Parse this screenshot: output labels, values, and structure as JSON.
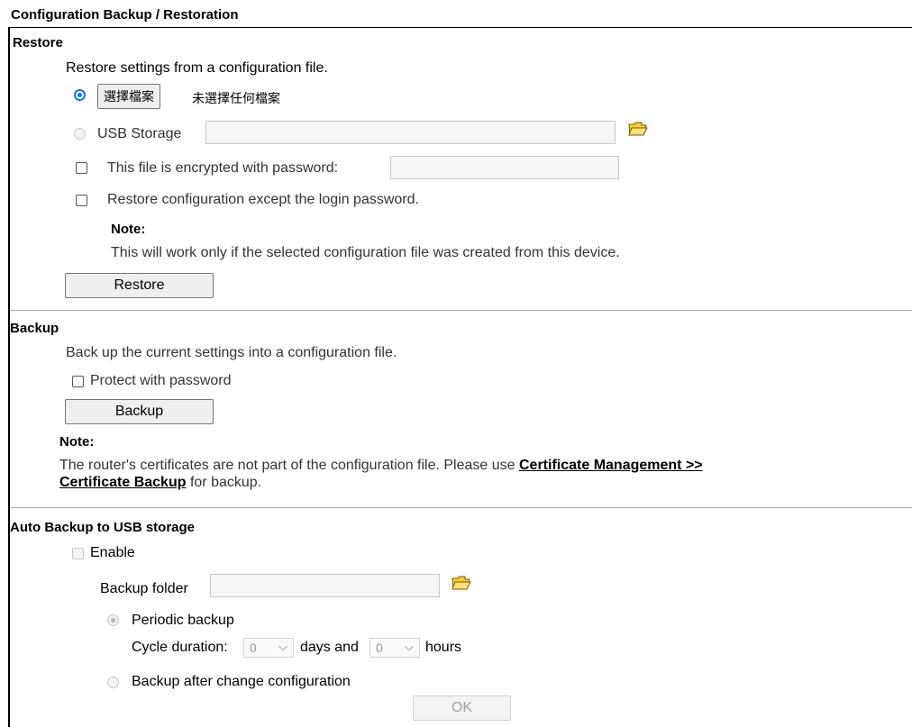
{
  "page_title": "Configuration Backup / Restoration",
  "restore": {
    "heading": "Restore",
    "description": "Restore settings from a configuration file.",
    "file_button_label": "選擇檔案",
    "file_status": "未選擇任何檔案",
    "usb_label": "USB Storage",
    "usb_path_value": "",
    "encrypted_label": "This file is encrypted with password:",
    "encrypted_password_value": "",
    "except_login_label": "Restore configuration except the login password.",
    "note_heading": "Note:",
    "note_text": "This will work only if the selected configuration file was created from this device.",
    "restore_button_label": "Restore"
  },
  "backup": {
    "heading": "Backup",
    "description": "Back up the current settings into a configuration file.",
    "protect_label": "Protect with password",
    "backup_button_label": "Backup",
    "note_heading": "Note:",
    "note_text_before": "The router's certificates are not part of the configuration file. Please use ",
    "note_link_line1": "Certificate Management >>",
    "note_link_line2": "Certificate Backup",
    "note_text_after": " for backup."
  },
  "auto_backup": {
    "heading": "Auto Backup to USB storage",
    "enable_label": "Enable",
    "folder_label": "Backup folder",
    "folder_value": "",
    "periodic_label": "Periodic backup",
    "cycle_label": "Cycle duration:",
    "days_value": "0",
    "days_unit": "days and",
    "hours_value": "0",
    "hours_unit": "hours",
    "after_change_label": "Backup after change configuration",
    "ok_button_label": "OK"
  },
  "icons": {
    "folder": "folder-icon",
    "chevron": "chevron-down-icon"
  },
  "colors": {
    "radio_selected": "#1a73e8",
    "divider": "#a7a7a7",
    "disabled_text": "#a0a0a0"
  }
}
